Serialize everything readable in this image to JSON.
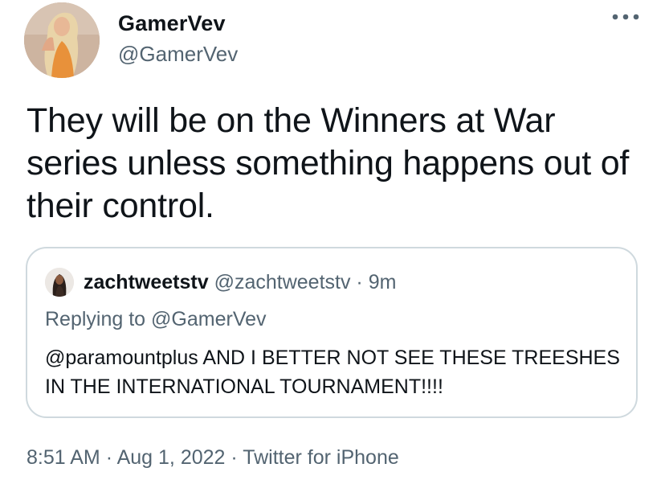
{
  "author": {
    "display_name": "GamerVev",
    "handle": "@GamerVev"
  },
  "tweet": {
    "text": "They will be on the Winners at War series unless something happens out of their control."
  },
  "quoted_tweet": {
    "display_name": "zachtweetstv",
    "handle": "@zachtweetstv",
    "separator": "·",
    "time_ago": "9m",
    "replying_prefix": "Replying to",
    "replying_to": "@GamerVev",
    "text": "@paramountplus AND I BETTER NOT SEE THESE TREESHES IN THE INTERNATIONAL TOURNAMENT!!!!"
  },
  "footer": {
    "time": "8:51 AM",
    "date": "Aug 1, 2022",
    "source": "Twitter for iPhone",
    "separator": "·"
  },
  "icons": {
    "more": "more-horizontal-icon"
  },
  "colors": {
    "text_primary": "#0f1419",
    "text_secondary": "#536471",
    "border": "#cfd9de"
  }
}
